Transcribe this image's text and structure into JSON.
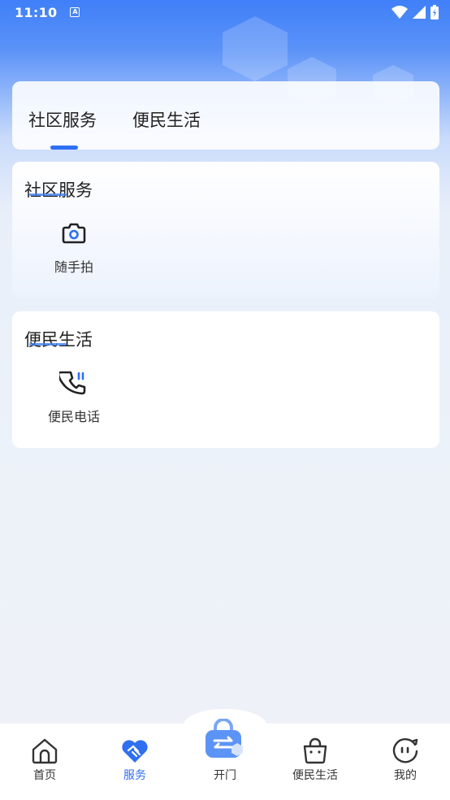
{
  "status_bar": {
    "time": "11:10",
    "a_badge": "A"
  },
  "tabs": [
    {
      "label": "社区服务",
      "active": true
    },
    {
      "label": "便民生活",
      "active": false
    }
  ],
  "sections": [
    {
      "title": "社区服务",
      "items": [
        {
          "label": "随手拍",
          "icon": "camera-icon"
        }
      ]
    },
    {
      "title": "便民生活",
      "items": [
        {
          "label": "便民电话",
          "icon": "phone-icon"
        }
      ]
    }
  ],
  "bottom_nav": [
    {
      "label": "首页",
      "icon": "home-icon",
      "active": false
    },
    {
      "label": "服务",
      "icon": "heart-handshake-icon",
      "active": true
    },
    {
      "label": "开门",
      "icon": "door-lock-icon",
      "active": false
    },
    {
      "label": "便民生活",
      "icon": "shopping-bag-icon",
      "active": false
    },
    {
      "label": "我的",
      "icon": "face-icon",
      "active": false
    }
  ],
  "colors": {
    "accent": "#2f6ff2",
    "header_blue": "#3f7ff8",
    "background": "#eef2f8"
  }
}
